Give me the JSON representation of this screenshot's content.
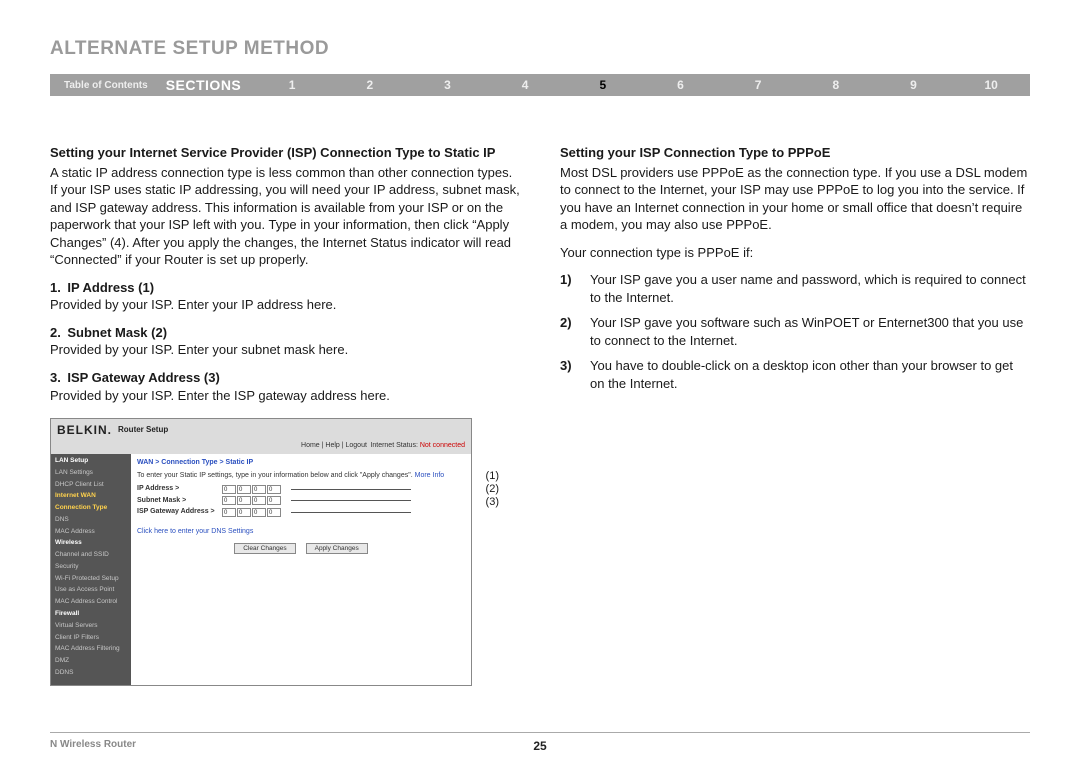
{
  "page_title": "ALTERNATE SETUP METHOD",
  "nav": {
    "toc": "Table of Contents",
    "sections": "SECTIONS",
    "numbers": [
      "1",
      "2",
      "3",
      "4",
      "5",
      "6",
      "7",
      "8",
      "9",
      "10"
    ],
    "current": "5"
  },
  "left": {
    "heading": "Setting your Internet Service Provider (ISP) Connection Type to Static IP",
    "para": "A static IP address connection type is less common than other connection types. If your ISP uses static IP addressing, you will need your IP address, subnet mask, and ISP gateway address. This information is available from your ISP or on the paperwork that your ISP left with you. Type in your information, then click “Apply Changes” (4). After you apply the changes, the Internet Status indicator will read “Connected” if your Router is set up properly.",
    "item1_label": "1. IP Address (1)",
    "item1_text": "Provided by your ISP. Enter your IP address here.",
    "item2_label": "2. Subnet Mask (2)",
    "item2_text": "Provided by your ISP. Enter your subnet mask here.",
    "item3_label": "3. ISP Gateway Address (3)",
    "item3_text": "Provided by your ISP. Enter the ISP gateway address here."
  },
  "right": {
    "heading": "Setting your ISP Connection Type to PPPoE",
    "para": "Most DSL providers use PPPoE as the connection type. If you use a DSL modem to connect to the Internet, your ISP may use PPPoE to log you into the service. If you have an Internet connection in your home or small office that doesn’t require a modem, you may also use PPPoE.",
    "intro": "Your connection type is PPPoE if:",
    "l1n": "1)",
    "l1t": "Your ISP gave you a user name and password, which is required to connect to the Internet.",
    "l2n": "2)",
    "l2t": "Your ISP gave you software such as WinPOET or Enternet300 that you use to connect to the Internet.",
    "l3n": "3)",
    "l3t": "You have to double-click on a desktop icon other than your browser to get on the Internet."
  },
  "router": {
    "brand": "BELKIN",
    "setup": "Router Setup",
    "top_links_a": "Home | Help | Logout Internet Status:",
    "top_links_b": "Not connected",
    "side": {
      "c1": "LAN Setup",
      "s1": "LAN Settings",
      "s2": "DHCP Client List",
      "c2": "Internet WAN",
      "s3": "Connection Type",
      "s4": "DNS",
      "s5": "MAC Address",
      "c3": "Wireless",
      "s6": "Channel and SSID",
      "s7": "Security",
      "s8": "Wi-Fi Protected Setup",
      "s9": "Use as Access Point",
      "s10": "MAC Address Control",
      "c4": "Firewall",
      "s11": "Virtual Servers",
      "s12": "Client IP Filters",
      "s13": "MAC Address Filtering",
      "s14": "DMZ",
      "s15": "DDNS"
    },
    "main": {
      "crumb": "WAN > Connection Type > Static IP",
      "instr_a": "To enter your Static IP settings, type in your information below and click \"Apply changes\".",
      "instr_b": "More Info",
      "f1": "IP Address >",
      "f2": "Subnet Mask >",
      "f3": "ISP Gateway Address >",
      "val": "0",
      "dns": "Click here to enter your DNS Settings",
      "btn_clear": "Clear Changes",
      "btn_apply": "Apply Changes"
    },
    "callouts": {
      "c1": "(1)",
      "c2": "(2)",
      "c3": "(3)"
    }
  },
  "footer": {
    "left": "N Wireless Router",
    "center": "25"
  }
}
